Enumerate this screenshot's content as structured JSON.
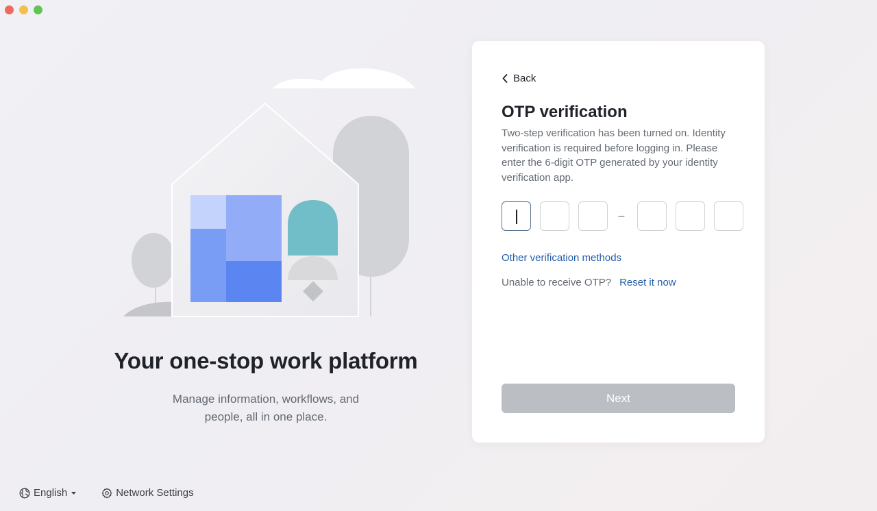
{
  "left_panel": {
    "headline": "Your one-stop work platform",
    "subtitle": "Manage information, workflows, and people, all in one place."
  },
  "footer": {
    "language_label": "English",
    "network_label": "Network Settings"
  },
  "card": {
    "back_label": "Back",
    "title": "OTP verification",
    "description": "Two-step verification has been turned on. Identity verification is required before logging in. Please enter the 6-digit OTP generated by your identity verification app.",
    "otp_separator": "–",
    "other_methods_label": "Other verification methods",
    "unable_text": "Unable to receive OTP?",
    "reset_label": "Reset it now",
    "next_label": "Next"
  },
  "icons": {
    "back": "chevron-left-icon",
    "language": "globe-icon",
    "language_dropdown": "caret-down-icon",
    "network": "gear-icon"
  },
  "colors": {
    "link": "#245ea8",
    "button_disabled": "#bbbfc4",
    "title": "#1f2329",
    "body_text": "#646a73"
  }
}
